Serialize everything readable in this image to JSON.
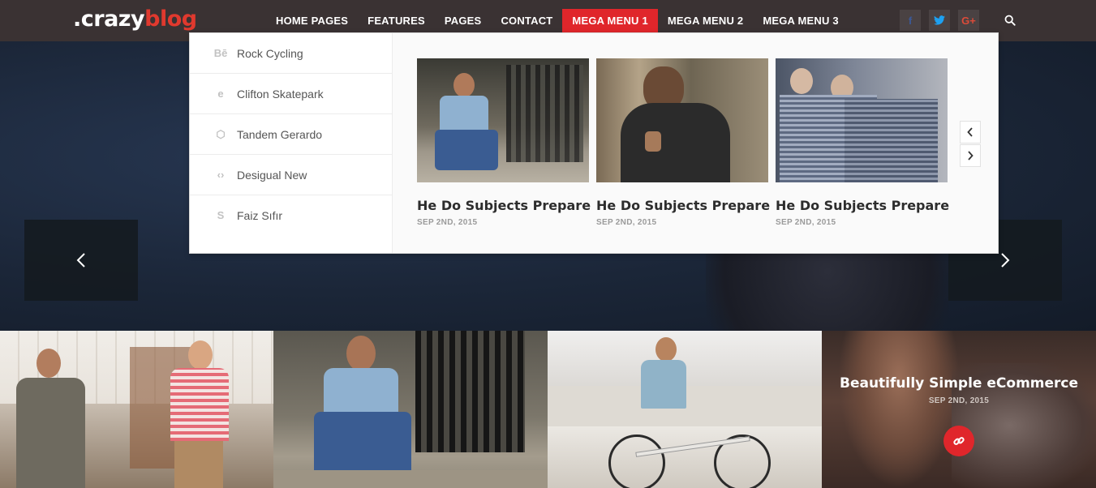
{
  "logo": {
    "part1": ".crazy",
    "part2": "blog"
  },
  "nav": {
    "items": [
      {
        "label": "HOME PAGES"
      },
      {
        "label": "FEATURES"
      },
      {
        "label": "PAGES"
      },
      {
        "label": "CONTACT"
      },
      {
        "label": "MEGA MENU 1",
        "active": true
      },
      {
        "label": "MEGA MENU 2"
      },
      {
        "label": "MEGA MENU 3"
      }
    ]
  },
  "social": {
    "facebook": {
      "glyph": "f",
      "icon": "facebook-icon"
    },
    "twitter": {
      "glyph": "t",
      "icon": "twitter-icon"
    },
    "googleplus": {
      "glyph": "G+",
      "icon": "google-plus-icon"
    }
  },
  "mega_menu": {
    "list": [
      {
        "label": "Rock Cycling",
        "glyph": "Bē",
        "icon": "behance-icon"
      },
      {
        "label": "Clifton Skatepark",
        "glyph": "e",
        "icon": "ie-icon"
      },
      {
        "label": "Tandem Gerardo",
        "glyph": "⬡",
        "icon": "codepen-icon"
      },
      {
        "label": "Desigual New",
        "glyph": "‹›",
        "icon": "code-icon"
      },
      {
        "label": "Faiz Sıfır",
        "glyph": "S",
        "icon": "skype-icon"
      }
    ],
    "posts": [
      {
        "title": "He Do Subjects Prepare",
        "date": "SEP 2ND, 2015"
      },
      {
        "title": "He Do Subjects Prepare",
        "date": "SEP 2ND, 2015"
      },
      {
        "title": "He Do Subjects Prepare",
        "date": "SEP 2ND, 2015"
      }
    ]
  },
  "feature": {
    "title": "Beautifully Simple eCommerce",
    "date": "SEP 2ND, 2015"
  },
  "colors": {
    "accent": "#e0262b",
    "header_bg": "#3a3233",
    "hero_bg": "#1b2638"
  }
}
